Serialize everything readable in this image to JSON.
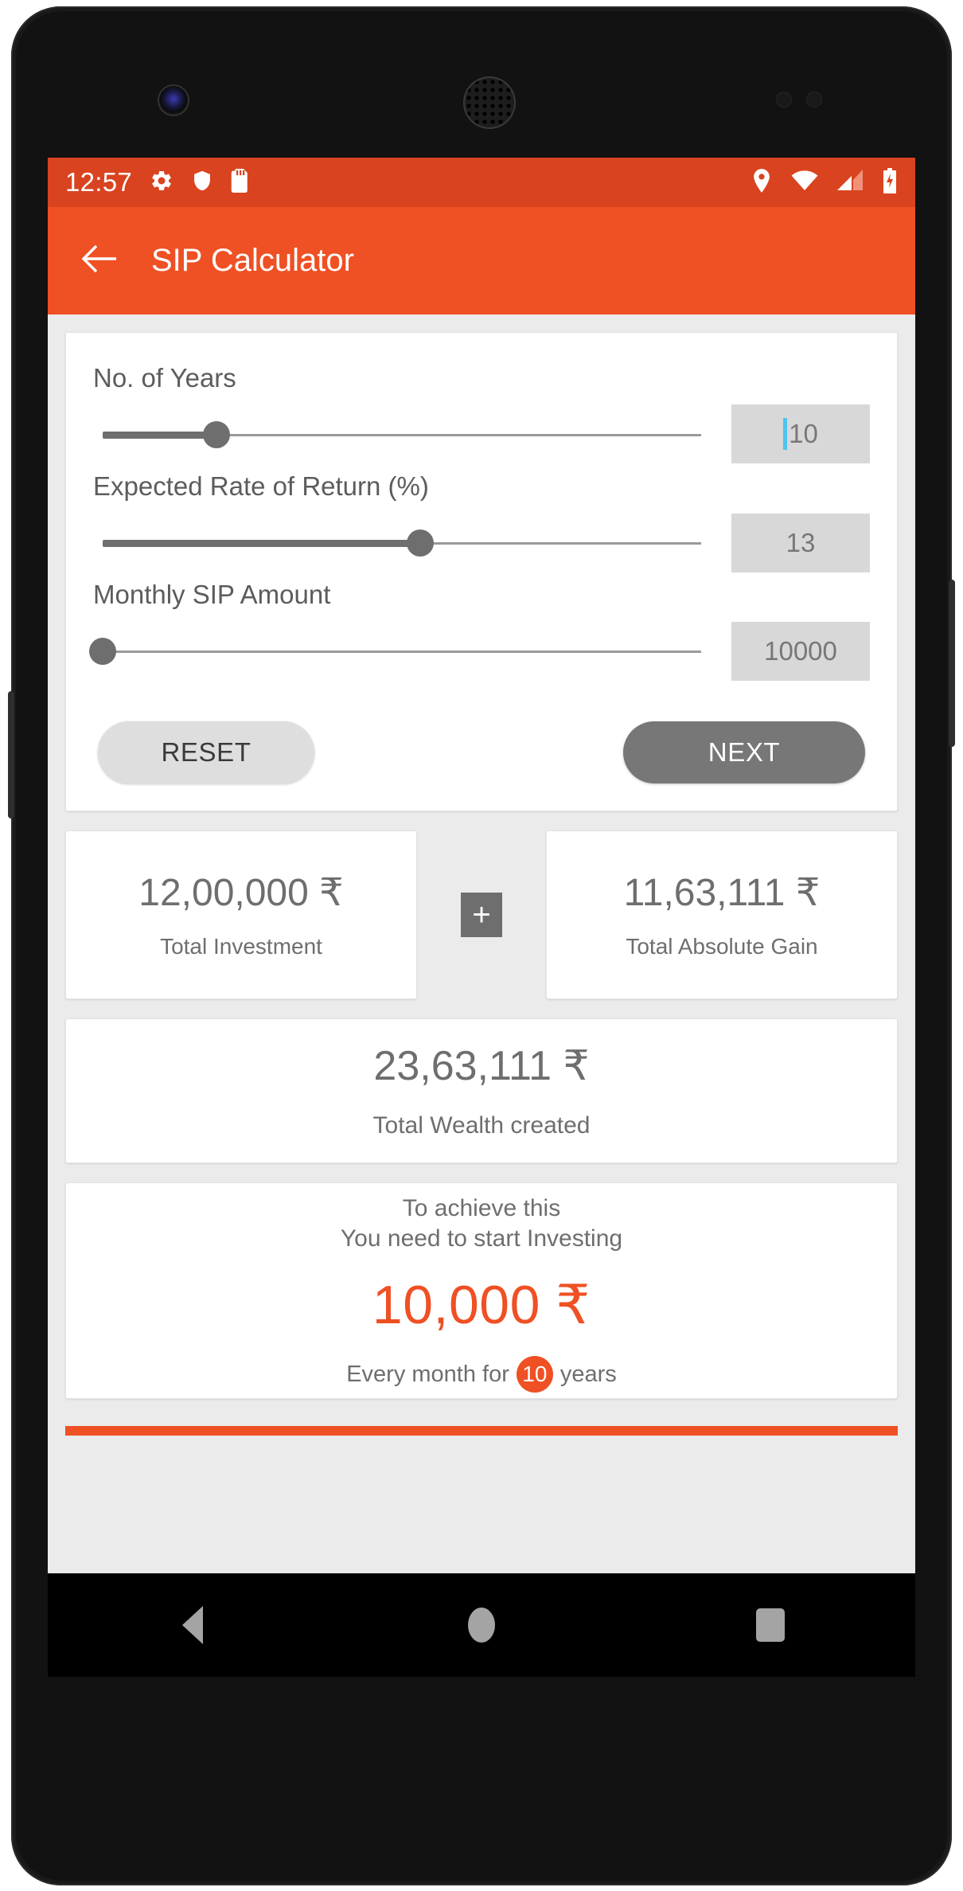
{
  "statusbar": {
    "clock": "12:57",
    "left_icons": [
      "gear-icon",
      "shield-icon",
      "sd-card-icon"
    ],
    "right_icons": [
      "location-icon",
      "wifi-icon",
      "signal-icon",
      "battery-charging-icon"
    ]
  },
  "appbar": {
    "back_icon": "arrow-left-icon",
    "title": "SIP Calculator",
    "bg_color": "#ef5024"
  },
  "form": {
    "fields": [
      {
        "label": "No. of Years",
        "value": "10",
        "slider_percent": 19,
        "has_caret": true
      },
      {
        "label": "Expected Rate of Return (%)",
        "value": "13",
        "slider_percent": 53,
        "has_caret": false
      },
      {
        "label": "Monthly SIP Amount",
        "value": "10000",
        "slider_percent": 0,
        "has_caret": false
      }
    ],
    "reset_label": "RESET",
    "next_label": "NEXT"
  },
  "results": {
    "investment": {
      "amount": "12,00,000 ₹",
      "caption": "Total Investment"
    },
    "operator": "+",
    "gain": {
      "amount": "11,63,111 ₹",
      "caption": "Total Absolute Gain"
    },
    "wealth": {
      "amount": "23,63,111 ₹",
      "caption": "Total Wealth created"
    }
  },
  "goal": {
    "line1": "To achieve this",
    "line2": "You need to start Investing",
    "amount": "10,000 ₹",
    "footer_prefix": "Every month for",
    "years_badge": "10",
    "footer_suffix": "years",
    "accent_color": "#ef5024"
  },
  "navbar": {
    "back": "nav-back-icon",
    "home": "nav-home-icon",
    "recents": "nav-recents-icon"
  }
}
